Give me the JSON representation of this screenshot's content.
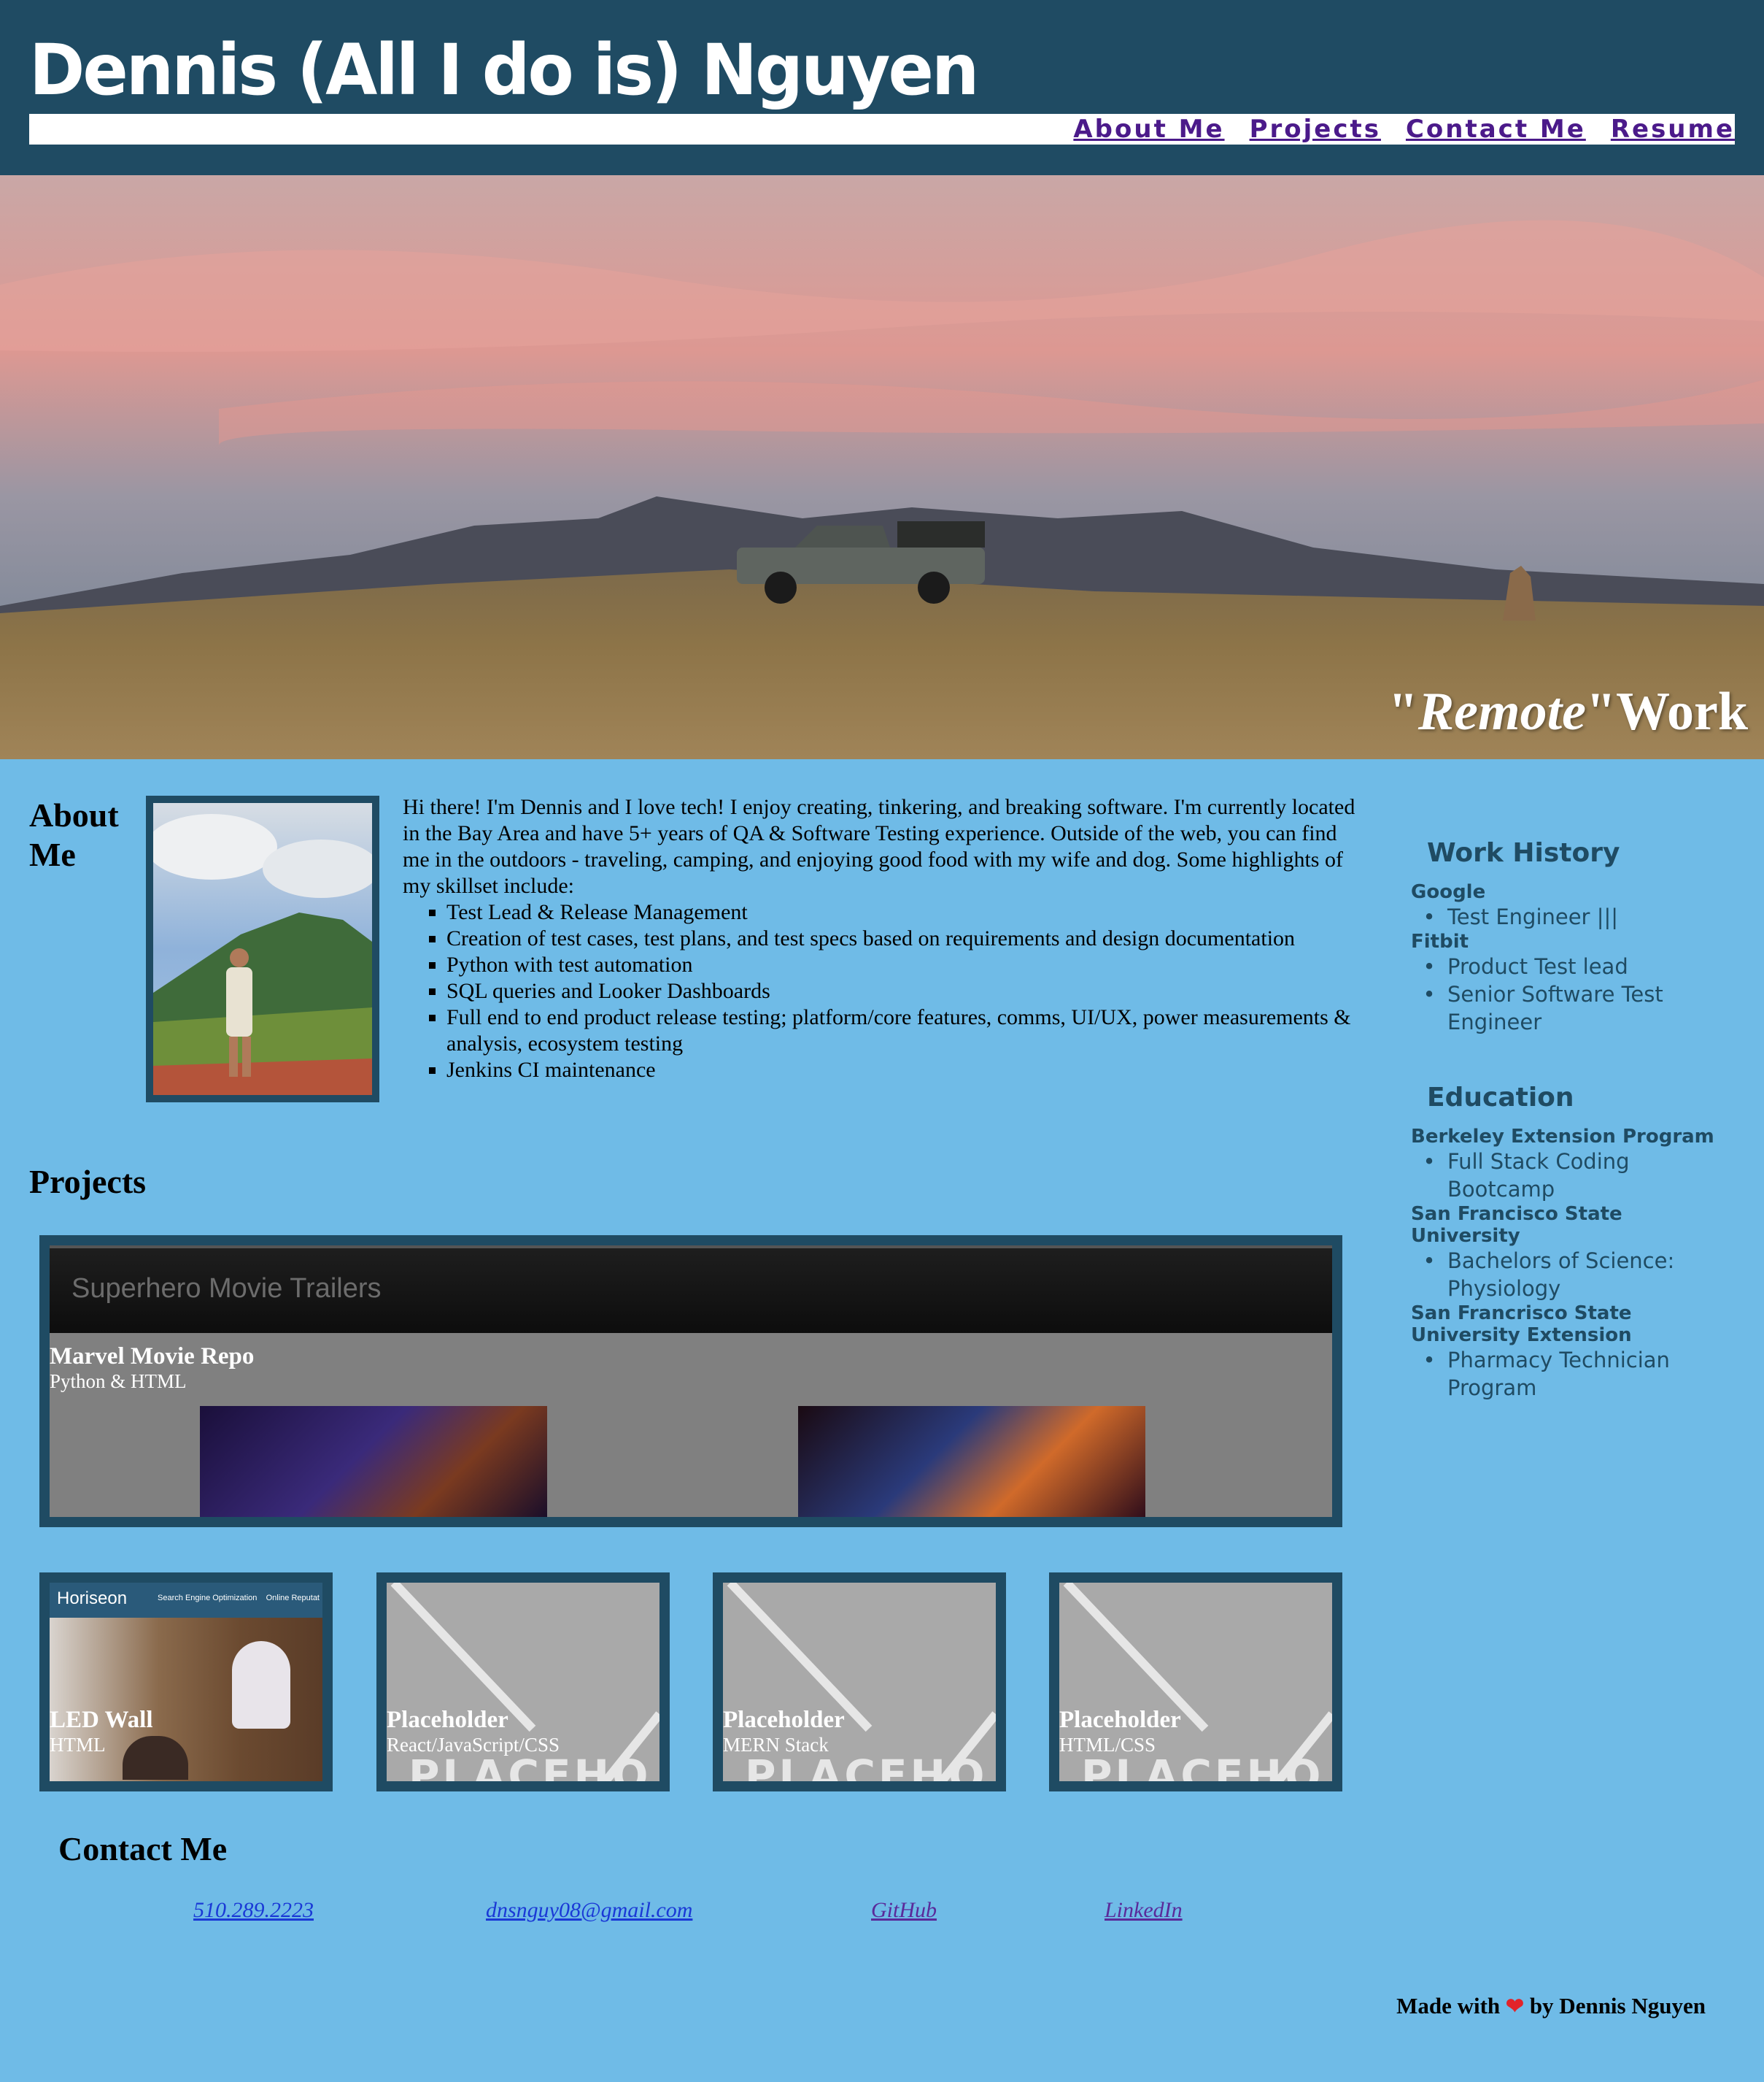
{
  "header": {
    "site_title": "Dennis (All I do is) Nguyen",
    "nav": [
      "About Me",
      "Projects",
      "Contact Me",
      "Resume"
    ]
  },
  "hero": {
    "caption_quote_open": "\"",
    "caption_em": "Remote",
    "caption_quote_close": "\"",
    "caption_rest": "Work"
  },
  "about": {
    "heading_line1": "About",
    "heading_line2": "Me",
    "intro": "Hi there! I'm Dennis and I love tech! I enjoy creating, tinkering, and breaking software. I'm currently located in the Bay Area and have 5+ years of QA & Software Testing experience. Outside of the web, you can find me in the outdoors - traveling, camping, and enjoying good food with my wife and dog. Some highlights of my skillset include:",
    "skills": [
      "Test Lead & Release Management",
      "Creation of test cases, test plans, and test specs based on requirements and design documentation",
      "Python with test automation",
      "SQL queries and Looker Dashboards",
      "Full end to end product release testing; platform/core features, comms, UI/UX, power measurements & analysis, ecosystem testing",
      "Jenkins CI maintenance"
    ]
  },
  "sidebar": {
    "work_heading": "Work History",
    "work": [
      {
        "org": "Google",
        "roles": [
          "Test Engineer |||"
        ]
      },
      {
        "org": "Fitbit",
        "roles": [
          "Product Test lead",
          "Senior Software Test Engineer"
        ]
      }
    ],
    "education_heading": "Education",
    "education": [
      {
        "org": "Berkeley Extension Program",
        "items": [
          "Full Stack Coding Bootcamp"
        ]
      },
      {
        "org": "San Francisco State University",
        "items": [
          "Bachelors of Science: Physiology"
        ]
      },
      {
        "org": "San Francrisco State University Extension",
        "items": [
          "Pharmacy Technician Program"
        ]
      }
    ]
  },
  "projects": {
    "heading": "Projects",
    "feature": {
      "screenshot_title": "Superhero Movie Trailers",
      "title": "Marvel Movie Repo",
      "tech": "Python & HTML"
    },
    "tiles": [
      {
        "title": "LED Wall",
        "tech": "HTML",
        "brand": "Horiseon",
        "nav": "Search Engine Optimization    Online Reputat"
      },
      {
        "title": "Placeholder",
        "tech": "React/JavaScript/CSS",
        "watermark": "PLACEHO"
      },
      {
        "title": "Placeholder",
        "tech": "MERN Stack",
        "watermark": "PLACEHO"
      },
      {
        "title": "Placeholder",
        "tech": "HTML/CSS",
        "watermark": "PLACEHO"
      }
    ]
  },
  "contact": {
    "heading": "Contact Me",
    "phone": "510.289.2223",
    "email": "dnsnguy08@gmail.com",
    "github": "GitHub",
    "linkedin": "LinkedIn"
  },
  "footer": {
    "made_with": "Made with",
    "by": "by Dennis Nguyen"
  },
  "colors": {
    "header_bg": "#1f4b63",
    "page_bg": "#6fbbe7",
    "nav_link": "#4b1a8a",
    "link_blue": "#1a39d6",
    "link_purple": "#5a2a9a"
  }
}
